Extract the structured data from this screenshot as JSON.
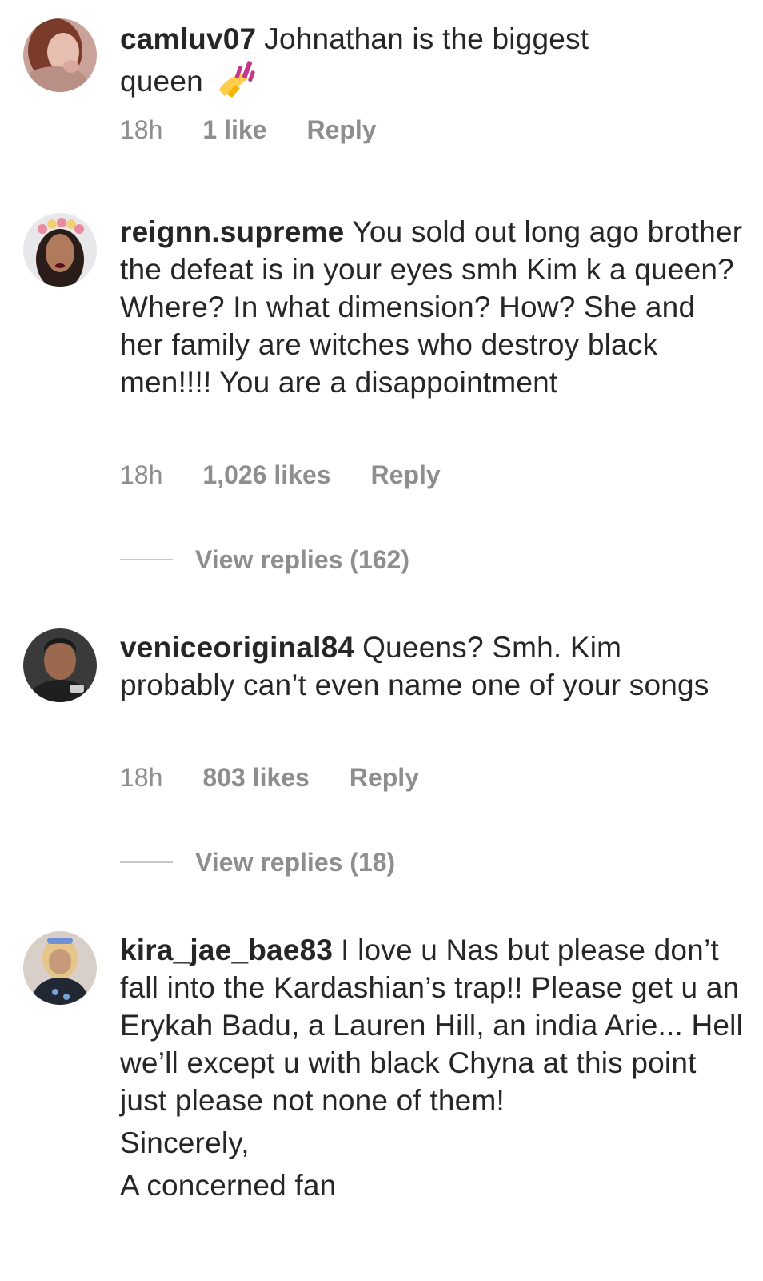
{
  "comments": [
    {
      "username": "camluv07",
      "text_lines": [
        "Johnathan is the biggest",
        "queen"
      ],
      "emoji": "nail-polish-icon",
      "time": "18h",
      "likes": "1 like",
      "reply": "Reply"
    },
    {
      "username": "reignn.supreme",
      "text": "You sold out long ago brother the defeat is in your eyes smh Kim k a queen? Where? In what dimension? How? She and her family are witches who destroy black men!!!! You are a disappointment",
      "time": "18h",
      "likes": "1,026 likes",
      "reply": "Reply",
      "view_replies": "View replies (162)"
    },
    {
      "username": "veniceoriginal84",
      "text": "Queens? Smh. Kim probably can’t even name one of your songs",
      "time": "18h",
      "likes": "803 likes",
      "reply": "Reply",
      "view_replies": "View replies (18)"
    },
    {
      "username": "kira_jae_bae83",
      "text": "I love u Nas but please don’t fall into the Kardashian’s trap!! Please get u an Erykah Badu, a Lauren Hill, an india Arie... Hell we’ll except u with black Chyna at this point just please not none of them!",
      "signoff_1": "Sincerely,",
      "signoff_2": "A concerned fan"
    }
  ]
}
